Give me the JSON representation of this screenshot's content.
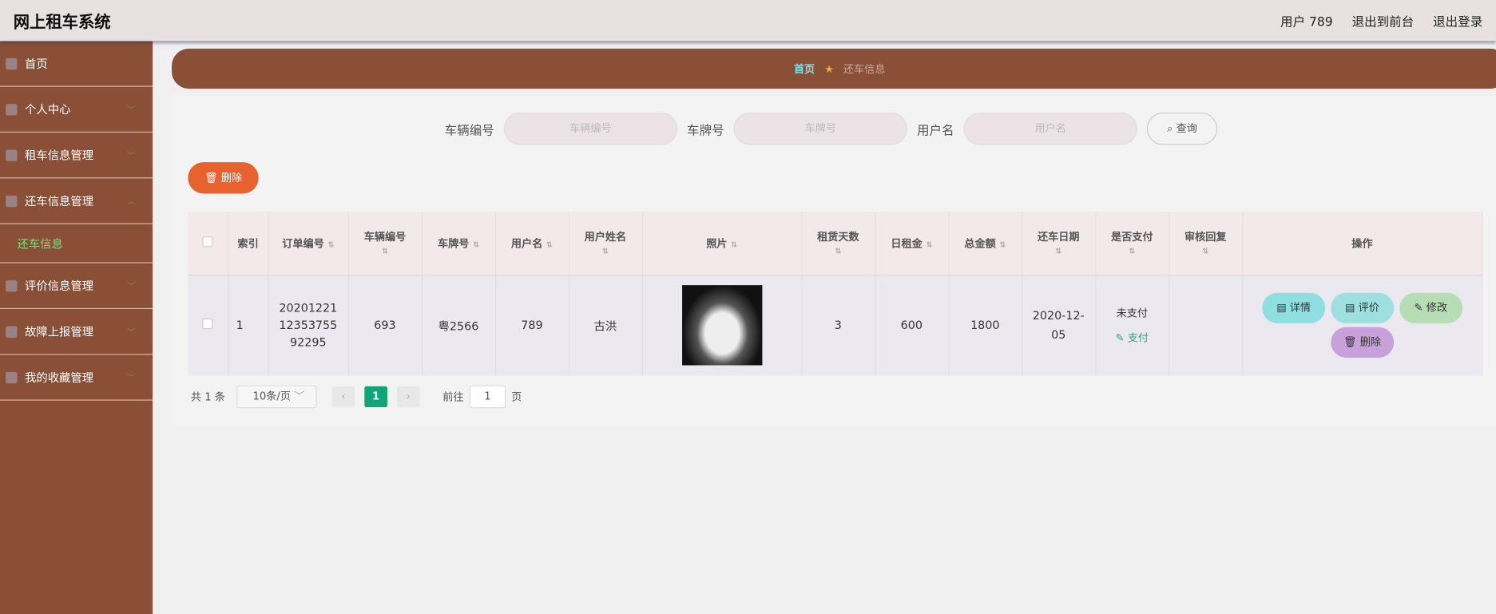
{
  "header": {
    "title": "网上租车系统",
    "user": "用户 789",
    "to_front": "退出到前台",
    "logout": "退出登录"
  },
  "sidebar": {
    "items": [
      {
        "label": "首页"
      },
      {
        "label": "个人中心"
      },
      {
        "label": "租车信息管理"
      },
      {
        "label": "还车信息管理"
      },
      {
        "label": "评价信息管理"
      },
      {
        "label": "故障上报管理"
      },
      {
        "label": "我的收藏管理"
      }
    ],
    "sub": "还车信息"
  },
  "breadcrumb": {
    "home": "首页",
    "current": "还车信息"
  },
  "search": {
    "vehicle_label": "车辆编号",
    "vehicle_ph": "车辆编号",
    "plate_label": "车牌号",
    "plate_ph": "车牌号",
    "user_label": "用户名",
    "user_ph": "用户名",
    "query": "查询"
  },
  "delete_label": "删除",
  "table": {
    "headers": [
      "索引",
      "订单编号",
      "车辆编号",
      "车牌号",
      "用户名",
      "用户姓名",
      "照片",
      "租赁天数",
      "日租金",
      "总金额",
      "还车日期",
      "是否支付",
      "审核回复",
      "操作"
    ],
    "row": {
      "index": "1",
      "order": "202012211235375592295",
      "vehicle": "693",
      "plate": "粤2566",
      "username": "789",
      "name": "古洪",
      "days": "3",
      "daily": "600",
      "total": "1800",
      "date": "2020-12-05",
      "paid": "未支付",
      "pay": "支付",
      "reply": ""
    },
    "actions": {
      "detail": "详情",
      "review": "评价",
      "edit": "修改",
      "delete": "删除"
    }
  },
  "pager": {
    "total": "共 1 条",
    "size": "10条/页",
    "page": "1",
    "goto": "前往",
    "goto_val": "1",
    "unit": "页"
  }
}
